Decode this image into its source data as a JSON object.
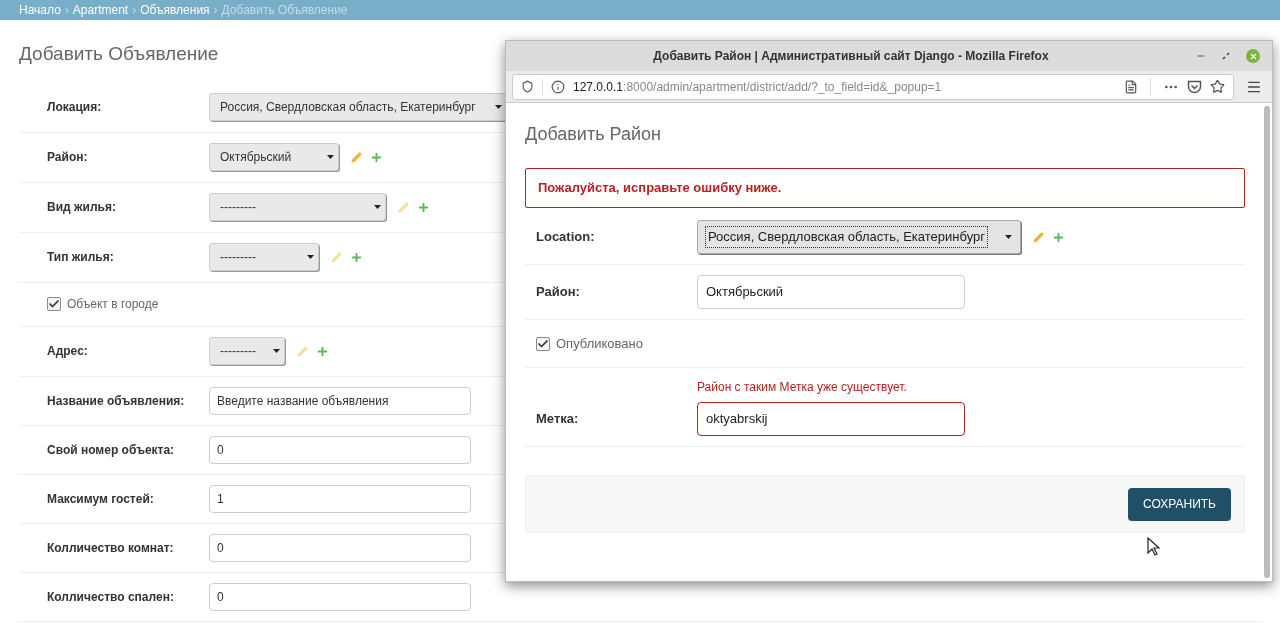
{
  "breadcrumbs": {
    "separator": "›",
    "items": [
      {
        "label": "Начало",
        "current": false
      },
      {
        "label": "Apartment",
        "current": false
      },
      {
        "label": "Объявления",
        "current": false
      },
      {
        "label": "Добавить Объявление",
        "current": true
      }
    ]
  },
  "page_title": "Добавить Объявление",
  "form_rows": [
    {
      "kind": "select",
      "label": "Локация:",
      "value": "Россия, Свердловская область, Екатеринбург"
    },
    {
      "kind": "select",
      "label": "Район:",
      "value": "Октябрьский",
      "edit_disabled": false
    },
    {
      "kind": "select",
      "label": "Вид жилья:",
      "value": "---------",
      "edit_disabled": true
    },
    {
      "kind": "select",
      "label": "Тип жилья:",
      "value": "---------",
      "edit_disabled": true
    },
    {
      "kind": "checkbox",
      "label": "Объект в городе",
      "checked": true
    },
    {
      "kind": "select",
      "label": "Адрес:",
      "value": "---------",
      "edit_disabled": true
    },
    {
      "kind": "text",
      "label": "Название объявления:",
      "value": "Введите название объявления"
    },
    {
      "kind": "text",
      "label": "Свой номер объекта:",
      "value": "0"
    },
    {
      "kind": "text",
      "label": "Максимум гостей:",
      "value": "1"
    },
    {
      "kind": "text",
      "label": "Колличество комнат:",
      "value": "0"
    },
    {
      "kind": "text",
      "label": "Колличество спален:",
      "value": "0"
    }
  ],
  "popup": {
    "window_title": "Добавить Район | Административный сайт Django - Mozilla Firefox",
    "url_host": "127.0.0.1",
    "url_path": ":8000/admin/apartment/district/add/?_to_field=id&_popup=1",
    "title": "Добавить Район",
    "error_note": "Пожалуйста, исправьте ошибку ниже.",
    "rows": [
      {
        "kind": "select",
        "label": "Location:",
        "value": "Россия, Свердловская область, Екатеринбург",
        "focused": true
      },
      {
        "kind": "text",
        "label": "Район:",
        "value": "Октябрьский",
        "error": false
      },
      {
        "kind": "checkbox",
        "label": "Опубликовано",
        "checked": true
      },
      {
        "kind": "text",
        "label": "Метка:",
        "value": "oktyabrskij",
        "error": true,
        "error_text": "Район с таким Метка уже существует."
      }
    ],
    "save_button": "СОХРАНИТЬ"
  }
}
